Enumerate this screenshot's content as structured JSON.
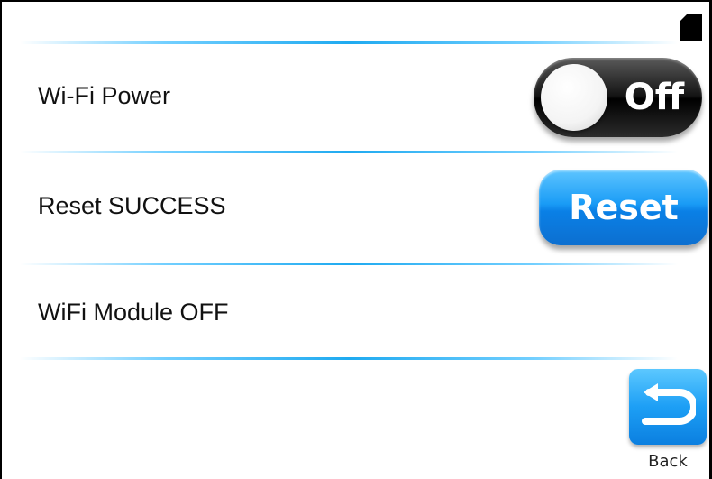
{
  "settings": {
    "rows": [
      {
        "label": "Wi-Fi Power",
        "control": "toggle",
        "value": "Off"
      },
      {
        "label": "Reset SUCCESS",
        "control": "button",
        "button_label": "Reset"
      },
      {
        "label": "WiFi Module OFF",
        "control": "none"
      }
    ]
  },
  "footer": {
    "back_label": "Back"
  },
  "icons": {
    "status": "sd-card-icon",
    "back": "return-arrow-icon"
  },
  "colors": {
    "accent": "#1a9cf6",
    "toggle_off": "#141414",
    "divider": "#1faaf0"
  }
}
